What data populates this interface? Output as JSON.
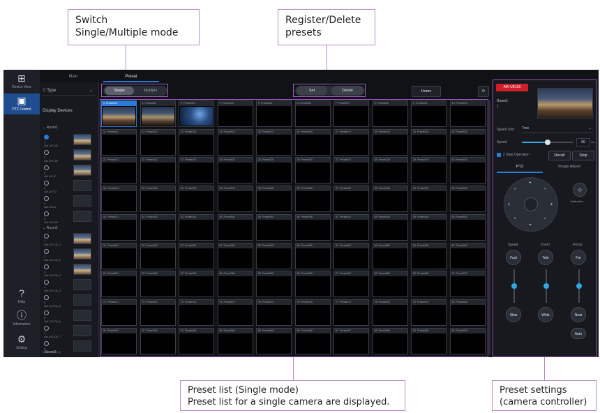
{
  "callouts": {
    "switch_mode": [
      "Switch",
      "Single/Multiple mode"
    ],
    "register_delete": [
      "Register/Delete",
      "presets"
    ],
    "preset_list": [
      "Preset list (Single mode)",
      "Preset list for a single camera are displayed."
    ],
    "preset_settings": [
      "Preset settings",
      "(camera controller)"
    ]
  },
  "leftbar": {
    "device_view": "Device View",
    "ptz_control": "PTZ Control",
    "help": "Help",
    "information": "Information",
    "setting": "Setting"
  },
  "tabs": {
    "main": "Main",
    "preset": "Preset"
  },
  "device_panel": {
    "type_label": "Type",
    "display_devices": "Display Devices",
    "groups": [
      "Room1",
      "Room2",
      "Room3"
    ],
    "room1": [
      {
        "name": "AW-UE150",
        "num": "1"
      },
      {
        "name": "AW-HE130",
        "num": "2"
      },
      {
        "name": "AW-HE40",
        "num": "3"
      },
      {
        "name": "AW-UE70",
        "num": "4"
      },
      {
        "name": "AW-HE42",
        "num": "5"
      },
      {
        "name": "AW-HR140",
        "num": "6"
      }
    ],
    "room2": [
      {
        "name": "AW-UE100_1",
        "num": "1"
      },
      {
        "name": "AW-UE100_2",
        "num": "2"
      },
      {
        "name": "AW-UE100_3",
        "num": "3"
      },
      {
        "name": "AW-UE100_4",
        "num": "4"
      },
      {
        "name": "AW-UE100_5",
        "num": "5"
      },
      {
        "name": "AW-UE100_6",
        "num": "6"
      },
      {
        "name": "AW-UE100_7",
        "num": "7"
      },
      {
        "name": "AW-UE100_8",
        "num": "8"
      }
    ]
  },
  "toolbar": {
    "single": "Single",
    "multiple": "Multiple",
    "set": "Set",
    "delete": "Delete",
    "home": "Home",
    "refresh_icon": "refresh-icon"
  },
  "presets": {
    "labels": [
      "Preset001",
      "Preset002",
      "Preset003",
      "Preset004",
      "Preset005",
      "Preset006",
      "Preset007",
      "Preset008",
      "Preset009",
      "Preset010",
      "Preset011",
      "Preset012",
      "Preset013",
      "Preset014",
      "Preset015",
      "Preset016",
      "Preset017",
      "Preset018",
      "Preset019",
      "Preset020",
      "Preset021",
      "Preset022",
      "Preset023",
      "Preset024",
      "Preset025",
      "Preset026",
      "Preset027",
      "Preset028",
      "Preset029",
      "Preset030",
      "Preset031",
      "Preset032",
      "Preset033",
      "Preset034",
      "Preset035",
      "Preset036",
      "Preset037",
      "Preset038",
      "Preset039",
      "Preset040",
      "Preset041",
      "Preset042",
      "Preset043",
      "Preset044",
      "Preset045",
      "Preset046",
      "Preset047",
      "Preset048",
      "Preset049",
      "Preset050",
      "Preset051",
      "Preset052",
      "Preset053",
      "Preset054",
      "Preset055",
      "Preset056",
      "Preset057",
      "Preset058",
      "Preset059",
      "Preset060",
      "Preset061",
      "Preset062",
      "Preset063",
      "Preset064",
      "Preset065",
      "Preset066",
      "Preset067",
      "Preset068",
      "Preset069",
      "Preset070",
      "Preset071",
      "Preset072",
      "Preset073",
      "Preset074",
      "Preset075",
      "Preset076",
      "Preset077",
      "Preset078",
      "Preset079",
      "Preset080",
      "Preset081",
      "Preset082",
      "Preset083",
      "Preset084",
      "Preset085",
      "Preset086",
      "Preset087",
      "Preset088",
      "Preset089",
      "Preset090"
    ],
    "selected_index": 0,
    "with_image": [
      0,
      1,
      2
    ]
  },
  "controller": {
    "camera_badge": "AW-UE150",
    "room": "Room1",
    "num": "1",
    "speed_unit_label": "Speed Unit",
    "speed_unit_value": "Tree",
    "speed_label": "Speed",
    "speed_value": "50",
    "speed_fraction": 0.5,
    "two_step": "2 Step Operation",
    "recall": "Recall",
    "stop": "Stop",
    "tab_ptz": "PTZ",
    "tab_image": "Image Adjust",
    "calibration": "Calibration",
    "speed_col": "Speed",
    "zoom_col": "Zoom",
    "focus_col": "Focus",
    "fast": "Fast",
    "slow": "Slow",
    "tele": "Tele",
    "wide": "Wide",
    "far": "Far",
    "near": "Near",
    "auto": "Auto"
  },
  "colors": {
    "accent": "#2a7bd6",
    "highlight": "#a25cc2",
    "badge": "#d01f2a"
  }
}
